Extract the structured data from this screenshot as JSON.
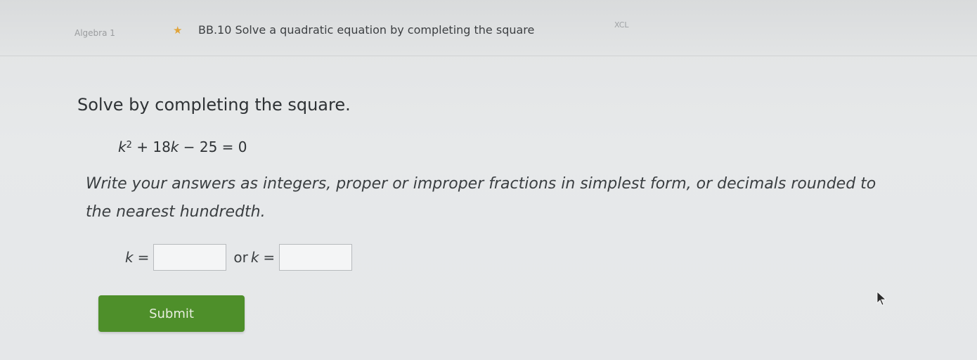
{
  "breadcrumb": {
    "course": "Algebra 1",
    "skill": "BB.10 Solve a quadratic equation by completing the square",
    "code": "XCL"
  },
  "question": {
    "prompt": "Solve by completing the square.",
    "equation": {
      "variable": "k",
      "exponent": "2",
      "rest": " + 18",
      "variable2": "k",
      "tail": " − 25 = 0"
    },
    "instructions": "Write your answers as integers, proper or improper fractions in simplest form, or decimals rounded to the nearest hundredth."
  },
  "answers": {
    "variable": "k",
    "equals": "=",
    "or_label": "or",
    "first_value": "",
    "second_value": ""
  },
  "submit_label": "Submit",
  "colors": {
    "accent": "#4e8f2a",
    "star": "#e0a43a",
    "top_bar": "#4a8fd6"
  }
}
